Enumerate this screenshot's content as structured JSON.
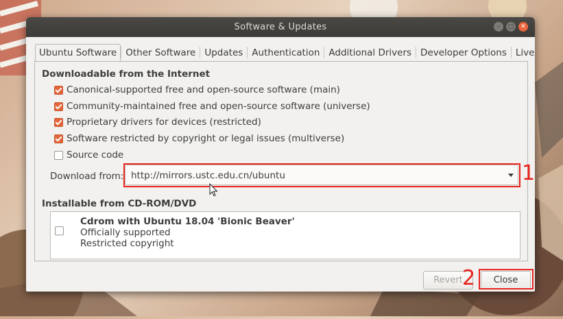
{
  "window": {
    "title": "Software & Updates",
    "controls": [
      "minimize",
      "maximize",
      "close"
    ]
  },
  "tabs": [
    {
      "label": "Ubuntu Software",
      "active": true
    },
    {
      "label": "Other Software",
      "active": false
    },
    {
      "label": "Updates",
      "active": false
    },
    {
      "label": "Authentication",
      "active": false
    },
    {
      "label": "Additional Drivers",
      "active": false
    },
    {
      "label": "Developer Options",
      "active": false
    },
    {
      "label": "Livepatch",
      "active": false
    }
  ],
  "downloadable": {
    "heading": "Downloadable from the Internet",
    "options": [
      {
        "label": "Canonical-supported free and open-source software (main)",
        "checked": true
      },
      {
        "label": "Community-maintained free and open-source software (universe)",
        "checked": true
      },
      {
        "label": "Proprietary drivers for devices (restricted)",
        "checked": true
      },
      {
        "label": "Software restricted by copyright or legal issues (multiverse)",
        "checked": true
      },
      {
        "label": "Source code",
        "checked": false
      }
    ],
    "download_from_label": "Download from:",
    "download_from_value": "http://mirrors.ustc.edu.cn/ubuntu"
  },
  "cdrom": {
    "heading": "Installable from CD-ROM/DVD",
    "item_title": "Cdrom with Ubuntu 18.04 'Bionic Beaver'",
    "item_line1": "Officially supported",
    "item_line2": "Restricted copyright",
    "checked": false
  },
  "buttons": {
    "revert": "Revert",
    "close": "Close"
  },
  "annotations": {
    "marker1": "1",
    "marker2": "2",
    "color": "#e8221c"
  },
  "colors": {
    "accent": "#e2653a",
    "titlebar": "#3c3b37"
  }
}
